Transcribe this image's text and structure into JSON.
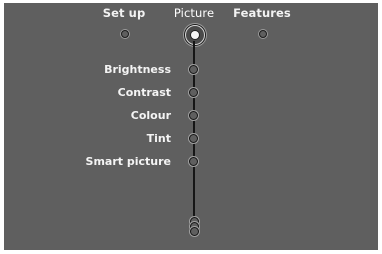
{
  "tabs": [
    {
      "label": "Set up",
      "active": false
    },
    {
      "label": "Picture",
      "active": true
    },
    {
      "label": "Features",
      "active": false
    }
  ],
  "menu": {
    "items": [
      {
        "label": "Brightness"
      },
      {
        "label": "Contrast"
      },
      {
        "label": "Colour"
      },
      {
        "label": "Tint"
      },
      {
        "label": "Smart picture"
      }
    ]
  },
  "colors": {
    "background": "#5f5f5f",
    "text": "#f4f4f4",
    "line": "#161616"
  },
  "icons": {
    "tab_marker": "circle-dot-icon",
    "active_tab_marker": "target-icon",
    "item_marker": "circle-dot-icon",
    "more_indicator": "stacked-dots-icon"
  }
}
